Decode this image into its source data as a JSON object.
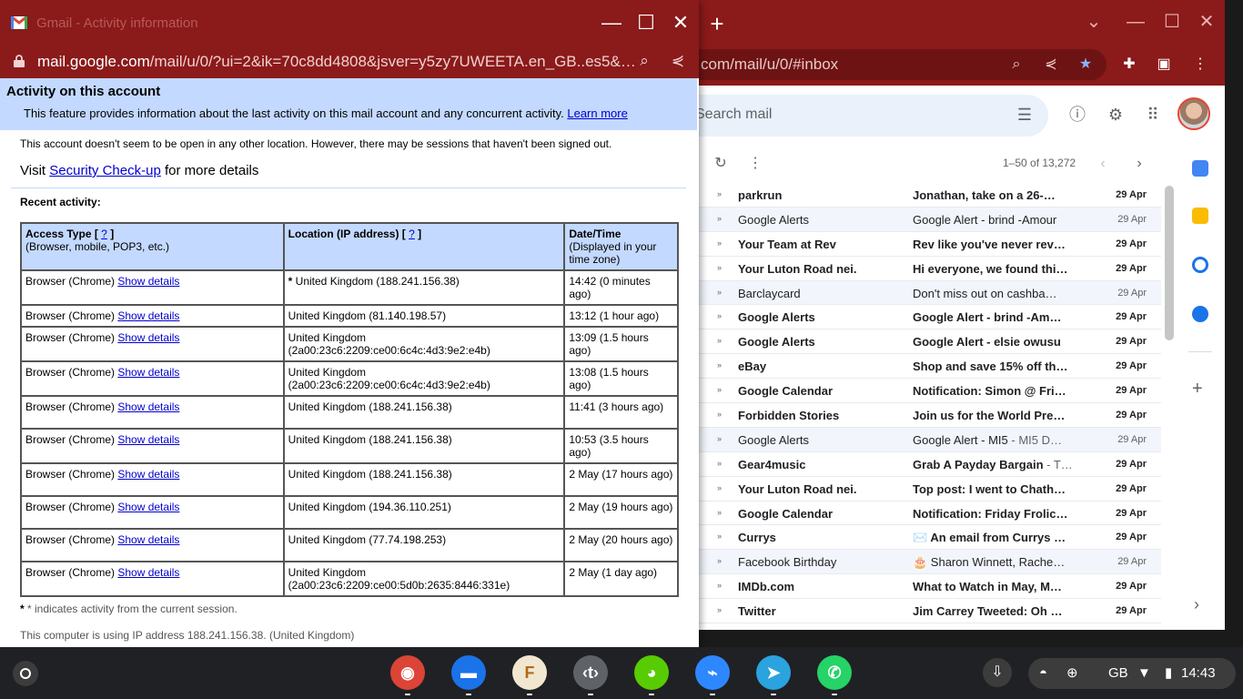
{
  "gmail": {
    "url": "com/mail/u/0/#inbox",
    "search_placeholder": "Search mail",
    "count": "1–50 of 13,272",
    "rows": [
      {
        "sender": "parkrun",
        "subject": "Jonathan, take on a 26-…",
        "snippet": "",
        "date": "29 Apr",
        "unread": true
      },
      {
        "sender": "Google Alerts",
        "subject": "Google Alert - brind -Amour",
        "snippet": "",
        "date": "29 Apr",
        "unread": false
      },
      {
        "sender": "Your Team at Rev",
        "subject": "Rev like you've never rev…",
        "snippet": "",
        "date": "29 Apr",
        "unread": true
      },
      {
        "sender": "Your Luton Road nei.",
        "subject": "Hi everyone, we found thi…",
        "snippet": "",
        "date": "29 Apr",
        "unread": true
      },
      {
        "sender": "Barclaycard",
        "subject": "Don't miss out on cashba…",
        "snippet": "",
        "date": "29 Apr",
        "unread": false
      },
      {
        "sender": "Google Alerts",
        "subject": "Google Alert - brind -Am…",
        "snippet": "",
        "date": "29 Apr",
        "unread": true
      },
      {
        "sender": "Google Alerts",
        "subject": "Google Alert - elsie owusu",
        "snippet": "",
        "date": "29 Apr",
        "unread": true
      },
      {
        "sender": "eBay",
        "subject": "Shop and save 15% off th…",
        "snippet": "",
        "date": "29 Apr",
        "unread": true
      },
      {
        "sender": "Google Calendar",
        "subject": "Notification: Simon @ Fri…",
        "snippet": "",
        "date": "29 Apr",
        "unread": true
      },
      {
        "sender": "Forbidden Stories",
        "subject": "Join us for the World Pre…",
        "snippet": "",
        "date": "29 Apr",
        "unread": true
      },
      {
        "sender": "Google Alerts",
        "subject": "Google Alert - MI5",
        "snippet": " - MI5 D…",
        "date": "29 Apr",
        "unread": false
      },
      {
        "sender": "Gear4music",
        "subject": "Grab A Payday Bargain",
        "snippet": " - T…",
        "date": "29 Apr",
        "unread": true
      },
      {
        "sender": "Your Luton Road nei.",
        "subject": "Top post: I went to Chath…",
        "snippet": "",
        "date": "29 Apr",
        "unread": true
      },
      {
        "sender": "Google Calendar",
        "subject": "Notification: Friday Frolic…",
        "snippet": "",
        "date": "29 Apr",
        "unread": true
      },
      {
        "sender": "Currys",
        "subject": "✉️ An email from Currys …",
        "snippet": "",
        "date": "29 Apr",
        "unread": true
      },
      {
        "sender": "Facebook Birthday",
        "subject": "🎂 Sharon Winnett, Rache…",
        "snippet": "",
        "date": "29 Apr",
        "unread": false
      },
      {
        "sender": "IMDb.com",
        "subject": "What to Watch in May, M…",
        "snippet": "",
        "date": "29 Apr",
        "unread": true
      },
      {
        "sender": "Twitter",
        "subject": "Jim Carrey Tweeted: Oh …",
        "snippet": "",
        "date": "29 Apr",
        "unread": true
      }
    ]
  },
  "popup": {
    "title": "Gmail - Activity information",
    "url_host": "mail.google.com",
    "url_path": "/mail/u/0/?ui=2&ik=70c8dd4808&jsver=y5zy7UWEETA.en_GB..es5&…",
    "banner_title": "Activity on this account",
    "banner_desc": "This feature provides information about the last activity on this mail account and any concurrent activity.",
    "learn_more": "Learn more",
    "notice": "This account doesn't seem to be open in any other location. However, there may be sessions that haven't been signed out.",
    "visit_prefix": "Visit",
    "visit_link": "Security Check-up",
    "visit_suffix": "for more details",
    "recent_label": "Recent activity:",
    "headers": {
      "access_type": "Access Type [",
      "access_type_help": "?",
      "access_type_close": "]",
      "access_type_sub": "(Browser, mobile, POP3, etc.)",
      "location": "Location (IP address) [",
      "location_help": "?",
      "location_close": "]",
      "datetime": "Date/Time",
      "datetime_sub": "(Displayed in your time zone)"
    },
    "show_details": "Show details",
    "rows": [
      {
        "access": "Browser (Chrome)",
        "location": "United Kingdom (188.241.156.38)",
        "current": true,
        "time": "14:42 (0 minutes ago)"
      },
      {
        "access": "Browser (Chrome)",
        "location": "United Kingdom (81.140.198.57)",
        "current": false,
        "time": "13:12 (1 hour ago)"
      },
      {
        "access": "Browser (Chrome)",
        "location": "United Kingdom (2a00:23c6:2209:ce00:6c4c:4d3:9e2:e4b)",
        "current": false,
        "time": "13:09 (1.5 hours ago)"
      },
      {
        "access": "Browser (Chrome)",
        "location": "United Kingdom (2a00:23c6:2209:ce00:6c4c:4d3:9e2:e4b)",
        "current": false,
        "time": "13:08 (1.5 hours ago)"
      },
      {
        "access": "Browser (Chrome)",
        "location": "United Kingdom (188.241.156.38)",
        "current": false,
        "time": "11:41 (3 hours ago)"
      },
      {
        "access": "Browser (Chrome)",
        "location": "United Kingdom (188.241.156.38)",
        "current": false,
        "time": "10:53 (3.5 hours ago)"
      },
      {
        "access": "Browser (Chrome)",
        "location": "United Kingdom (188.241.156.38)",
        "current": false,
        "time": "2 May (17 hours ago)"
      },
      {
        "access": "Browser (Chrome)",
        "location": "United Kingdom (194.36.110.251)",
        "current": false,
        "time": "2 May (19 hours ago)"
      },
      {
        "access": "Browser (Chrome)",
        "location": "United Kingdom (77.74.198.253)",
        "current": false,
        "time": "2 May (20 hours ago)"
      },
      {
        "access": "Browser (Chrome)",
        "location": "United Kingdom (2a00:23c6:2209:ce00:5d0b:2635:8446:331e)",
        "current": false,
        "time": "2 May (1 day ago)"
      }
    ],
    "footnote": "* indicates activity from the current session.",
    "ip_note": "This computer is using IP address 188.241.156.38. (United Kingdom)"
  },
  "shelf": {
    "apps": [
      {
        "name": "chrome-icon",
        "color": "#db4437"
      },
      {
        "name": "files-icon",
        "color": "#1a73e8"
      },
      {
        "name": "fiverr-app-icon",
        "color": "#f1e7d0"
      },
      {
        "name": "text-editor-icon",
        "color": "#5f6368"
      },
      {
        "name": "duolingo-icon",
        "color": "#58cc02"
      },
      {
        "name": "messenger-icon",
        "color": "#2d88ff"
      },
      {
        "name": "telegram-icon",
        "color": "#2aa3df"
      },
      {
        "name": "whatsapp-icon",
        "color": "#25d366"
      }
    ],
    "keyboard": "GB",
    "time": "14:43"
  }
}
